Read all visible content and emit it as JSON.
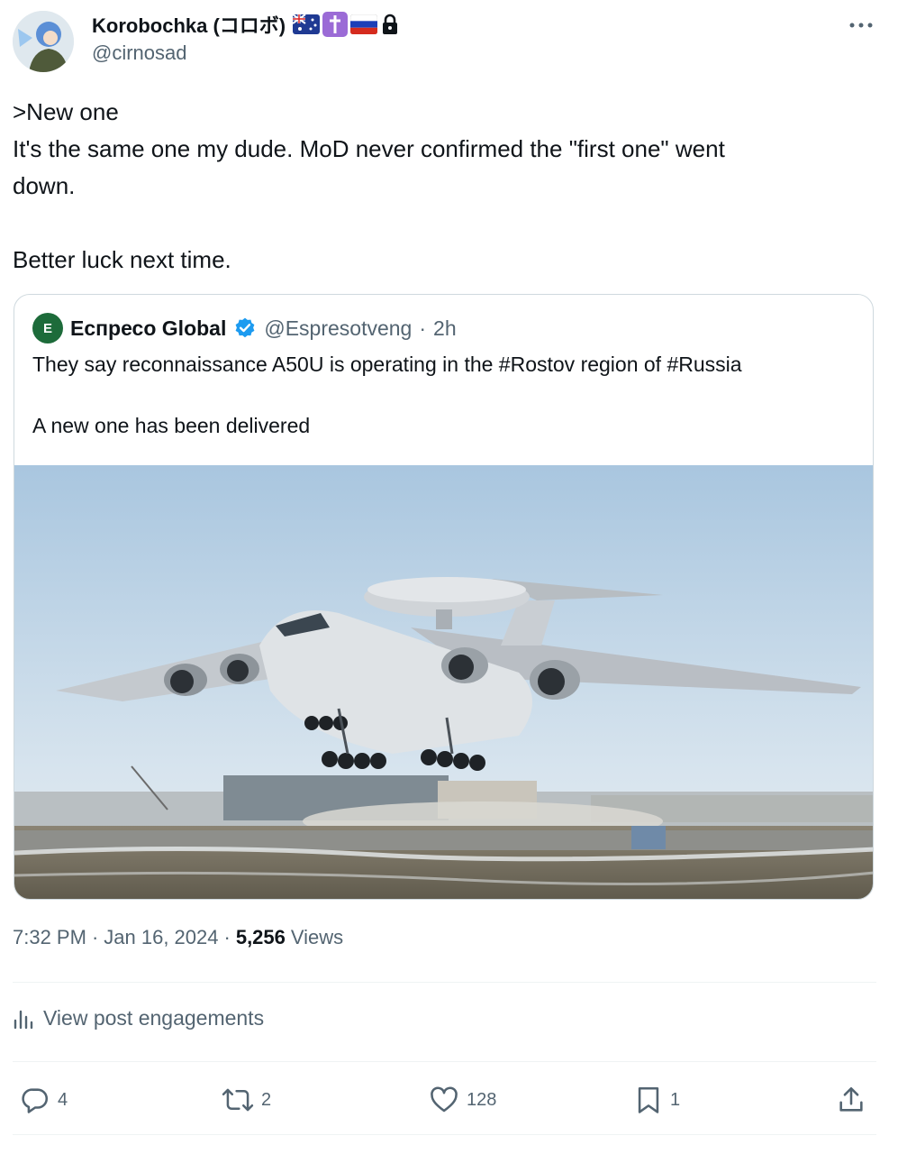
{
  "author": {
    "display_name": "Korobochka (コロボ)",
    "handle": "@cirnosad",
    "badges": [
      "australia-flag-icon",
      "cross-icon",
      "russia-flag-icon",
      "lock-icon"
    ]
  },
  "tweet": {
    "lines": [
      ">New one",
      "It's the same one my dude. MoD never confirmed the \"first one\" went",
      "down.",
      "",
      "Better luck next time."
    ]
  },
  "quote": {
    "avatar_letter": "E",
    "display_name": "Еспресо Global",
    "handle": "@Espresotveng",
    "separator": "·",
    "time": "2h",
    "line1": "They say reconnaissance A50U is operating in the #Rostov region of #Russia",
    "line2": "A new one has been delivered"
  },
  "meta": {
    "time": "7:32 PM",
    "sep1": "·",
    "date": "Jan 16, 2024",
    "sep2": "·",
    "views_count": "5,256",
    "views_label": "Views"
  },
  "engagements": {
    "label": "View post engagements"
  },
  "actions": {
    "replies": "4",
    "reposts": "2",
    "likes": "128",
    "bookmarks": "1"
  },
  "colors": {
    "text": "#0f1419",
    "secondary": "#536471",
    "border": "#cfd9de",
    "verified": "#1d9bf0"
  }
}
